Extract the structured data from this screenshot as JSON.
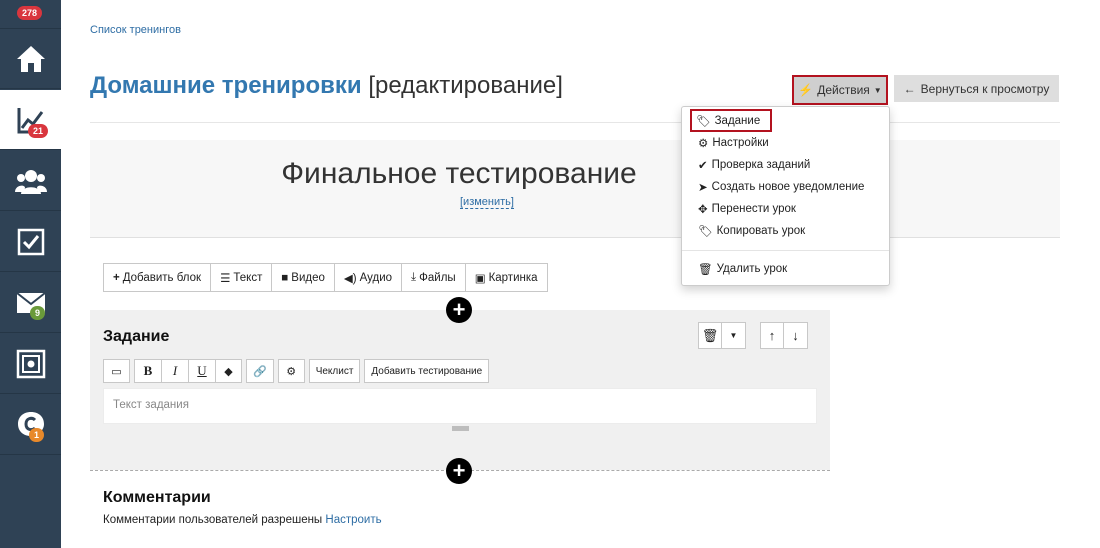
{
  "sidebar": {
    "badges": {
      "top": "278",
      "trainings": "21",
      "mail": "9",
      "support": "1"
    },
    "items": [
      {
        "name": "home",
        "icon": "home-icon"
      },
      {
        "name": "trainings",
        "icon": "chart-icon"
      },
      {
        "name": "users",
        "icon": "users-icon"
      },
      {
        "name": "tasks",
        "icon": "checkbox-icon"
      },
      {
        "name": "mail",
        "icon": "envelope-icon"
      },
      {
        "name": "safe",
        "icon": "safe-icon"
      },
      {
        "name": "support",
        "icon": "chat-icon"
      }
    ]
  },
  "breadcrumb": "Список тренингов",
  "page_title": {
    "course": "Домашние тренировки",
    "mode": "[редактирование]"
  },
  "header_buttons": {
    "actions": "Действия",
    "back": "Вернуться к просмотру"
  },
  "dropdown": {
    "items": [
      "Задание",
      "Настройки",
      "Проверка заданий",
      "Создать новое уведомление",
      "Перенести урок",
      "Копировать урок"
    ],
    "delete": "Удалить урок"
  },
  "lesson": {
    "name": "Финальное тестирование",
    "edit_link": "[изменить]"
  },
  "block_bar": [
    "Добавить блок",
    "Текст",
    "Видео",
    "Аудио",
    "Файлы",
    "Картинка"
  ],
  "task": {
    "title": "Задание",
    "toolbar": {
      "checklist": "Чеклист",
      "add_test": "Добавить тестирование"
    },
    "placeholder": "Текст задания"
  },
  "comments": {
    "title": "Комментарии",
    "text": "Комментарии пользователей разрешены",
    "link": "Настроить"
  },
  "colors": {
    "sidebar": "#2f4255",
    "link": "#2e6da4",
    "highlight_border": "#b3121f"
  }
}
